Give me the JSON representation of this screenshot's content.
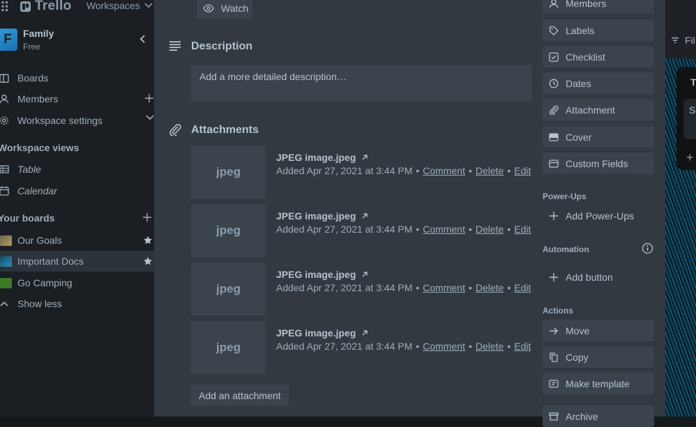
{
  "topnav": {
    "logo": "Trello",
    "workspaces": "Workspaces"
  },
  "workspace": {
    "initial": "F",
    "name": "Family",
    "plan": "Free"
  },
  "sidebar": {
    "nav": [
      {
        "label": "Boards",
        "icon": "board-icon"
      },
      {
        "label": "Members",
        "icon": "person-icon"
      },
      {
        "label": "Workspace settings",
        "icon": "gear-icon"
      }
    ],
    "views_title": "Workspace views",
    "views": [
      {
        "label": "Table",
        "icon": "table-icon"
      },
      {
        "label": "Calendar",
        "icon": "calendar-icon"
      }
    ],
    "boards_title": "Your boards",
    "boards": [
      {
        "label": "Our Goals",
        "color": "#8a7a4a"
      },
      {
        "label": "Important Docs",
        "color": "#1e6b8f"
      },
      {
        "label": "Go Camping",
        "color": "#3f7a26"
      }
    ],
    "show_less": "Show less"
  },
  "card": {
    "watch_label": "Watch",
    "description": {
      "title": "Description",
      "placeholder": "Add a more detailed description…"
    },
    "attachments": {
      "title": "Attachments",
      "items": [
        {
          "thumb": "jpeg",
          "name": "JPEG image.jpeg",
          "added": "Added Apr 27, 2021 at 3:44 PM",
          "comment": "Comment",
          "delete": "Delete",
          "edit": "Edit"
        },
        {
          "thumb": "jpeg",
          "name": "JPEG image.jpeg",
          "added": "Added Apr 27, 2021 at 3:44 PM",
          "comment": "Comment",
          "delete": "Delete",
          "edit": "Edit"
        },
        {
          "thumb": "jpeg",
          "name": "JPEG image.jpeg",
          "added": "Added Apr 27, 2021 at 3:44 PM",
          "comment": "Comment",
          "delete": "Delete",
          "edit": "Edit"
        },
        {
          "thumb": "jpeg",
          "name": "JPEG image.jpeg",
          "added": "Added Apr 27, 2021 at 3:44 PM",
          "comment": "Comment",
          "delete": "Delete",
          "edit": "Edit"
        }
      ],
      "add_label": "Add an attachment"
    }
  },
  "side": {
    "add_to": [
      {
        "label": "Members",
        "icon": "person-icon"
      },
      {
        "label": "Labels",
        "icon": "tag-icon"
      },
      {
        "label": "Checklist",
        "icon": "checklist-icon"
      },
      {
        "label": "Dates",
        "icon": "clock-icon"
      },
      {
        "label": "Attachment",
        "icon": "paperclip-icon"
      },
      {
        "label": "Cover",
        "icon": "cover-icon"
      },
      {
        "label": "Custom Fields",
        "icon": "custom-fields-icon"
      }
    ],
    "powerups_title": "Power-Ups",
    "add_powerups": "Add Power-Ups",
    "automation_title": "Automation",
    "add_button": "Add button",
    "actions_title": "Actions",
    "actions": [
      {
        "label": "Move",
        "icon": "arrow-right-icon"
      },
      {
        "label": "Copy",
        "icon": "copy-icon"
      },
      {
        "label": "Make template",
        "icon": "template-icon"
      },
      {
        "label": "Archive",
        "icon": "archive-icon"
      }
    ]
  },
  "board_bg": {
    "filter": "Fil",
    "list_title": "T",
    "card_text": "S"
  },
  "colors": {
    "sidebar_bg": "#1b1f23",
    "modal_bg": "#323940",
    "button_bg": "#3b444c",
    "text": "#b6c2cf"
  }
}
